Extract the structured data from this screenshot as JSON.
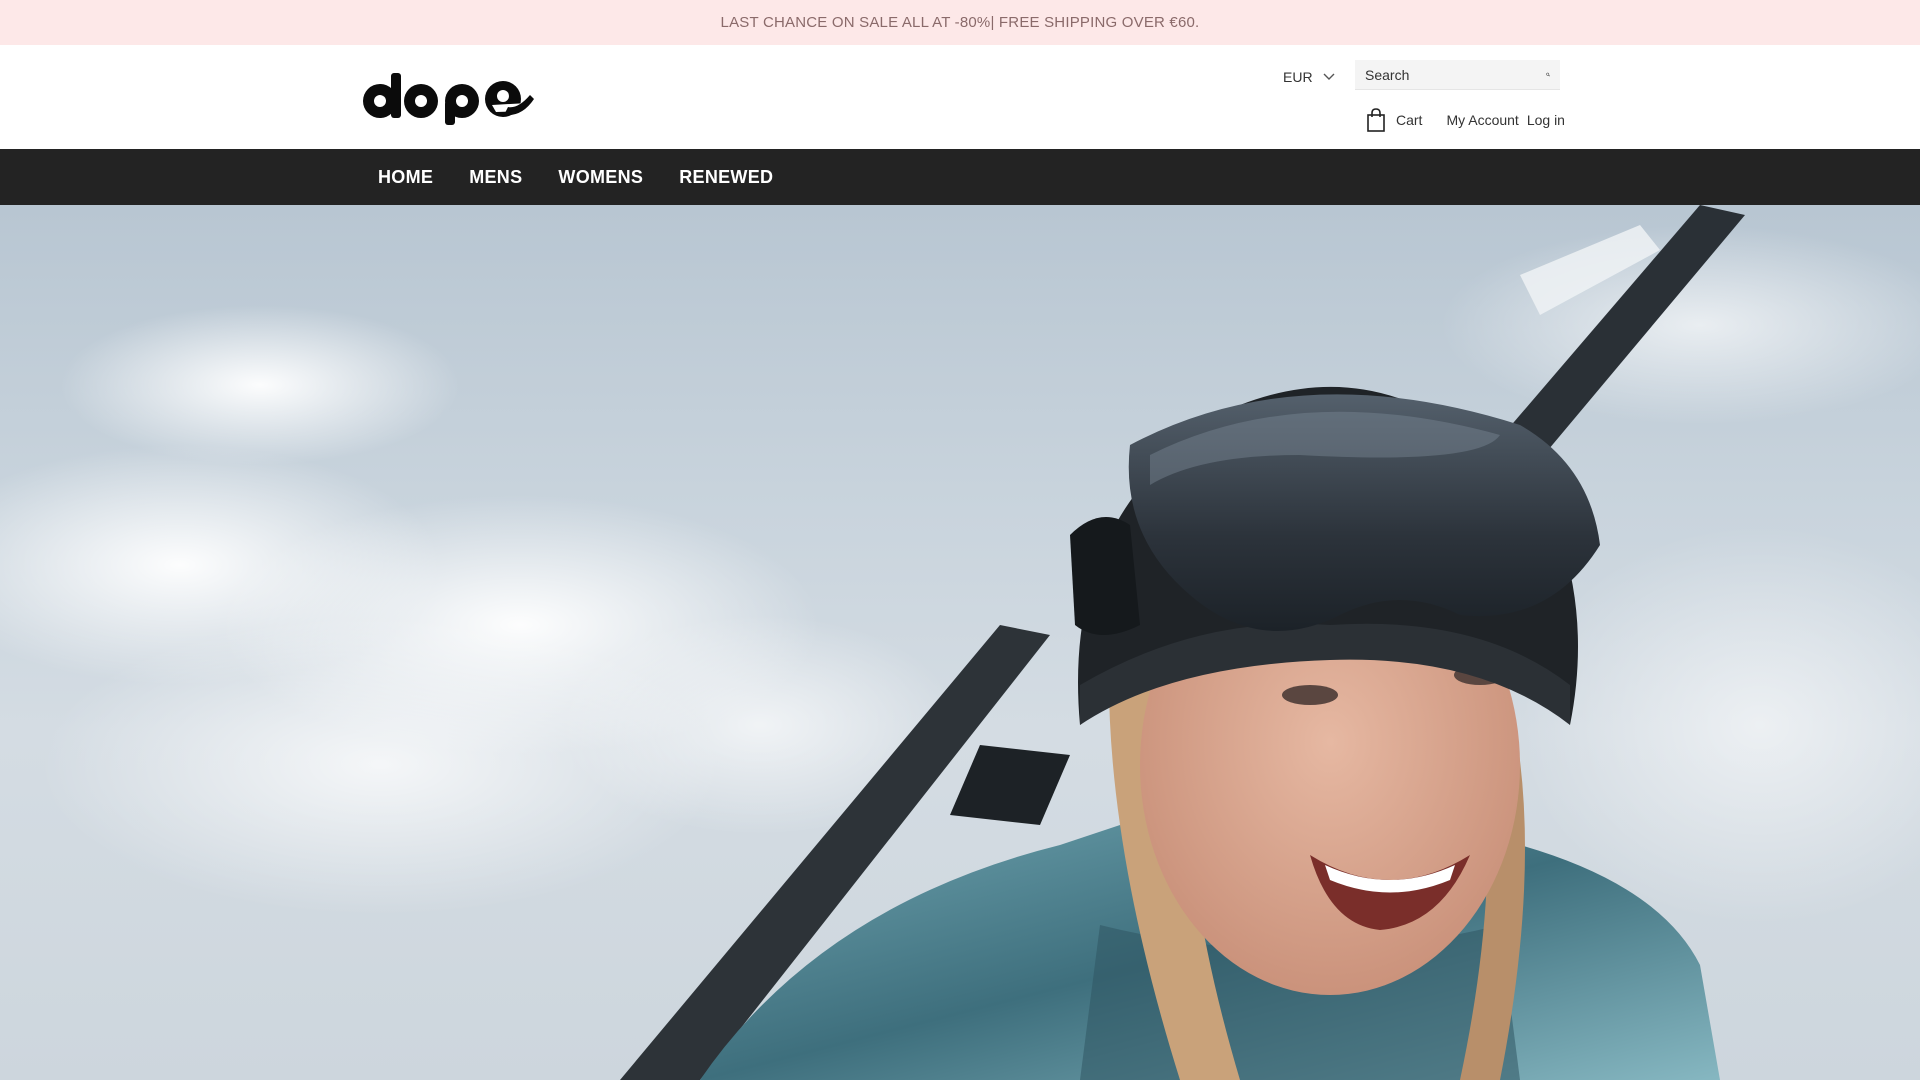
{
  "announcement": {
    "text": "LAST CHANCE ON SALE ALL AT -80%| FREE SHIPPING OVER €60."
  },
  "header": {
    "logo_text": "dope",
    "currency": "EUR",
    "search_placeholder": "Search",
    "cart_label": "Cart",
    "account_label": "My Account",
    "login_label": "Log in"
  },
  "nav": {
    "items": [
      "HOME",
      "MENS",
      "WOMENS",
      "RENEWED"
    ]
  },
  "hero": {
    "image": "skier-woman-with-goggles-and-skis"
  },
  "colors": {
    "announcement_bg": "#fde8e8",
    "nav_bg": "#232323",
    "nav_text": "#ffffff"
  }
}
